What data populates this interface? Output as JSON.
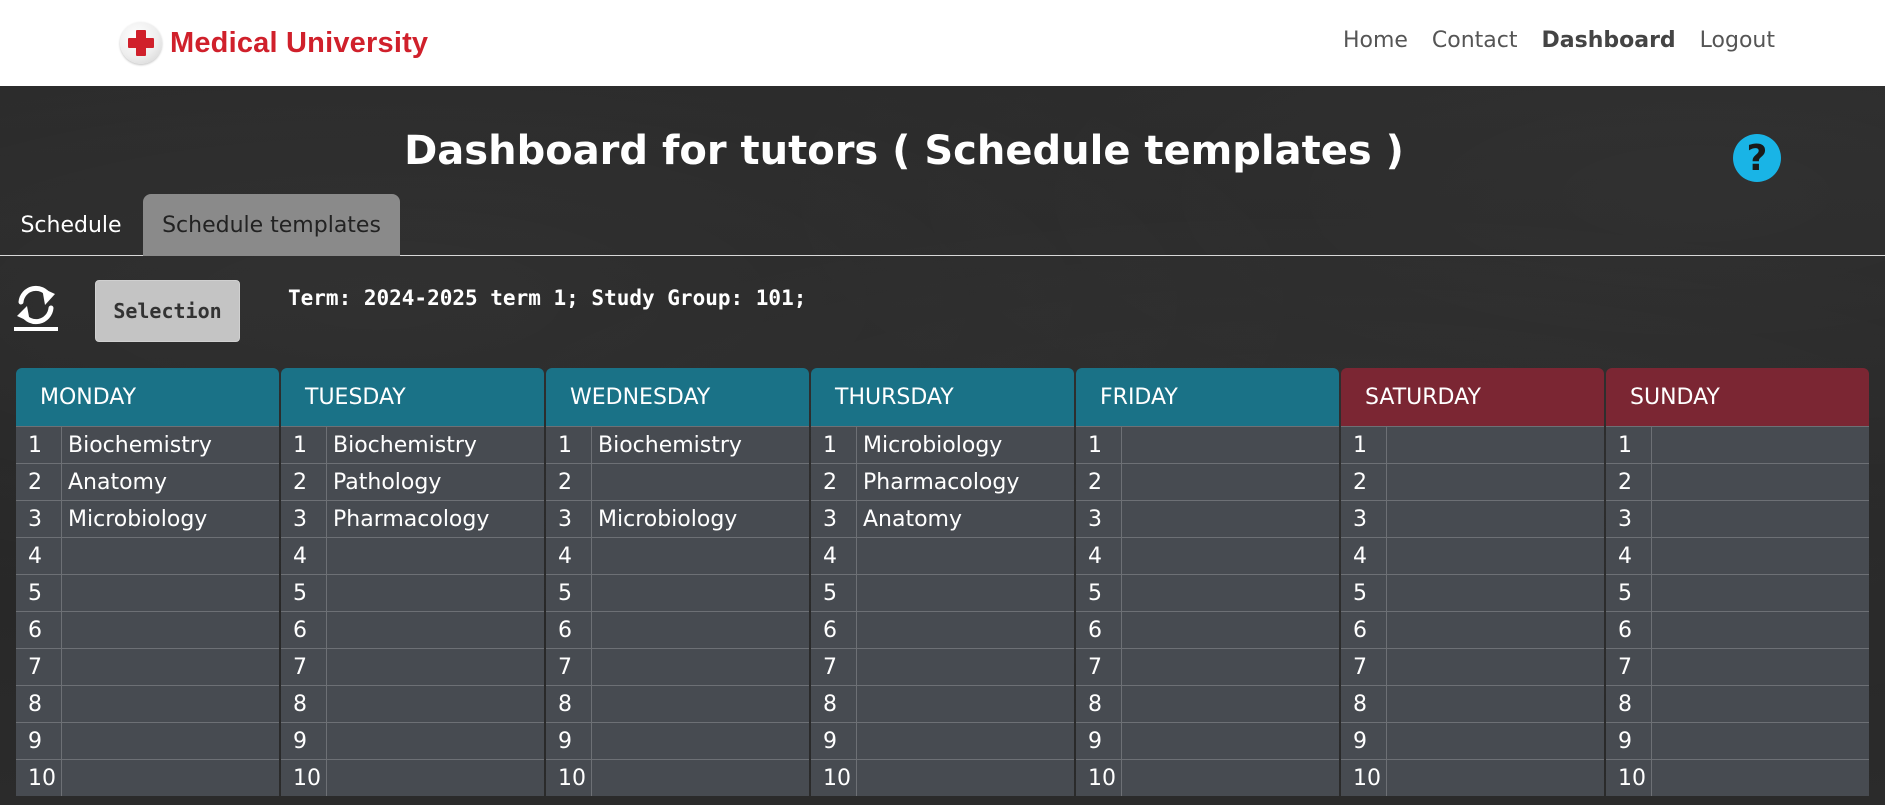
{
  "nav": {
    "brand": "Medical University",
    "links": [
      {
        "label": "Home",
        "active": false
      },
      {
        "label": "Contact",
        "active": false
      },
      {
        "label": "Dashboard",
        "active": true
      },
      {
        "label": "Logout",
        "active": false
      }
    ]
  },
  "page": {
    "title": "Dashboard for tutors ( Schedule templates )",
    "help_icon": "question-icon"
  },
  "tabs": [
    {
      "label": "Schedule",
      "selected": false
    },
    {
      "label": "Schedule templates",
      "selected": true
    }
  ],
  "toolbar": {
    "refresh_icon": "refresh-icon",
    "selection_label": "Selection",
    "term_info": "Term: 2024-2025 term 1; Study Group: 101;"
  },
  "colors": {
    "brand": "#d0202b",
    "weekday_header": "#1a7287",
    "weekend_header": "#7b2633",
    "help_button": "#19b4e6",
    "cell_bg": "#474b51"
  },
  "schedule": {
    "days": [
      {
        "name": "MONDAY",
        "weekend": false,
        "lessons": [
          "1",
          "2",
          "3",
          "4",
          "5",
          "6",
          "7",
          "8",
          "9",
          "10"
        ],
        "subjects": [
          "Biochemistry",
          "Anatomy",
          "Microbiology",
          "",
          "",
          "",
          "",
          "",
          "",
          ""
        ]
      },
      {
        "name": "TUESDAY",
        "weekend": false,
        "lessons": [
          "1",
          "2",
          "3",
          "4",
          "5",
          "6",
          "7",
          "8",
          "9",
          "10"
        ],
        "subjects": [
          "Biochemistry",
          "Pathology",
          "Pharmacology",
          "",
          "",
          "",
          "",
          "",
          "",
          ""
        ]
      },
      {
        "name": "WEDNESDAY",
        "weekend": false,
        "lessons": [
          "1",
          "2",
          "3",
          "4",
          "5",
          "6",
          "7",
          "8",
          "9",
          "10"
        ],
        "subjects": [
          "Biochemistry",
          "",
          "Microbiology",
          "",
          "",
          "",
          "",
          "",
          "",
          ""
        ]
      },
      {
        "name": "THURSDAY",
        "weekend": false,
        "lessons": [
          "1",
          "2",
          "3",
          "4",
          "5",
          "6",
          "7",
          "8",
          "9",
          "10"
        ],
        "subjects": [
          "Microbiology",
          "Pharmacology",
          "Anatomy",
          "",
          "",
          "",
          "",
          "",
          "",
          ""
        ]
      },
      {
        "name": "FRIDAY",
        "weekend": false,
        "lessons": [
          "1",
          "2",
          "3",
          "4",
          "5",
          "6",
          "7",
          "8",
          "9",
          "10"
        ],
        "subjects": [
          "",
          "",
          "",
          "",
          "",
          "",
          "",
          "",
          "",
          ""
        ]
      },
      {
        "name": "SATURDAY",
        "weekend": true,
        "lessons": [
          "1",
          "2",
          "3",
          "4",
          "5",
          "6",
          "7",
          "8",
          "9",
          "10"
        ],
        "subjects": [
          "",
          "",
          "",
          "",
          "",
          "",
          "",
          "",
          "",
          ""
        ]
      },
      {
        "name": "SUNDAY",
        "weekend": true,
        "lessons": [
          "1",
          "2",
          "3",
          "4",
          "5",
          "6",
          "7",
          "8",
          "9",
          "10"
        ],
        "subjects": [
          "",
          "",
          "",
          "",
          "",
          "",
          "",
          "",
          "",
          ""
        ]
      }
    ]
  }
}
